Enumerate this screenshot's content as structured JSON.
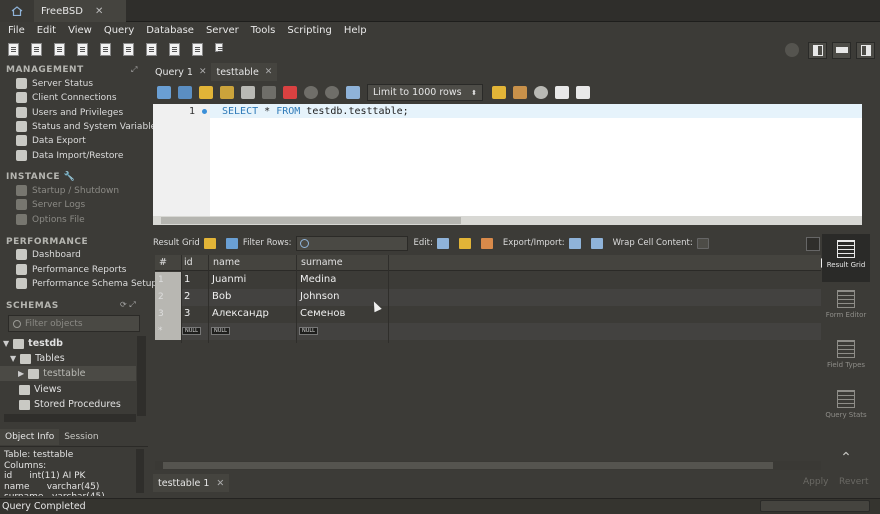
{
  "tabs": {
    "home_icon": "home-icon",
    "connection": "FreeBSD",
    "close": "✕"
  },
  "menu": [
    "File",
    "Edit",
    "View",
    "Query",
    "Database",
    "Server",
    "Tools",
    "Scripting",
    "Help"
  ],
  "sidebar": {
    "management": {
      "heading": "MANAGEMENT",
      "items": [
        "Server Status",
        "Client Connections",
        "Users and Privileges",
        "Status and System Variables",
        "Data Export",
        "Data Import/Restore"
      ]
    },
    "instance": {
      "heading": "INSTANCE",
      "items": [
        "Startup / Shutdown",
        "Server Logs",
        "Options File"
      ]
    },
    "performance": {
      "heading": "PERFORMANCE",
      "items": [
        "Dashboard",
        "Performance Reports",
        "Performance Schema Setup"
      ]
    },
    "schemas": {
      "heading": "SCHEMAS",
      "filter_placeholder": "Filter objects",
      "tree": {
        "db": "testdb",
        "tables": "Tables",
        "table": "testtable",
        "views": "Views",
        "procs": "Stored Procedures"
      }
    },
    "info_tabs": {
      "object_info": "Object Info",
      "session": "Session"
    },
    "object_info": "Table: testtable\nColumns:\nid      int(11) AI PK\nname      varchar(45)\nsurname   varchar(45)"
  },
  "query_tabs": [
    {
      "label": "Query 1",
      "close": "✕"
    },
    {
      "label": "testtable",
      "close": "✕"
    }
  ],
  "editor": {
    "limit": "Limit to 1000 rows",
    "line": "1",
    "sql_keyword1": "SELECT",
    "sql_mid": " * ",
    "sql_keyword2": "FROM",
    "sql_rest": " testdb.testtable;"
  },
  "result_toolbar": {
    "result_grid": "Result Grid",
    "filter_rows": "Filter Rows:",
    "edit": "Edit:",
    "export_import": "Export/Import:",
    "wrap": "Wrap Cell Content:"
  },
  "grid": {
    "headers": [
      "#",
      "id",
      "name",
      "surname"
    ],
    "rows": [
      {
        "n": "1",
        "id": "1",
        "name": "Juanmi",
        "surname": "Medina"
      },
      {
        "n": "2",
        "id": "2",
        "name": "Bob",
        "surname": "Johnson"
      },
      {
        "n": "3",
        "id": "3",
        "name": "Александр",
        "surname": "Семенов"
      }
    ],
    "null_row": {
      "marker": "*",
      "null": "NULL"
    }
  },
  "side_panel": [
    {
      "label": "Result Grid",
      "active": true
    },
    {
      "label": "Form Editor",
      "active": false
    },
    {
      "label": "Field Types",
      "active": false
    },
    {
      "label": "Query Stats",
      "active": false
    }
  ],
  "result_tab": {
    "label": "testtable 1",
    "close": "✕"
  },
  "apply": "Apply",
  "revert": "Revert",
  "status": "Query Completed",
  "colors": {
    "accent": "#2e7ab8",
    "background": "#3c3b37"
  }
}
